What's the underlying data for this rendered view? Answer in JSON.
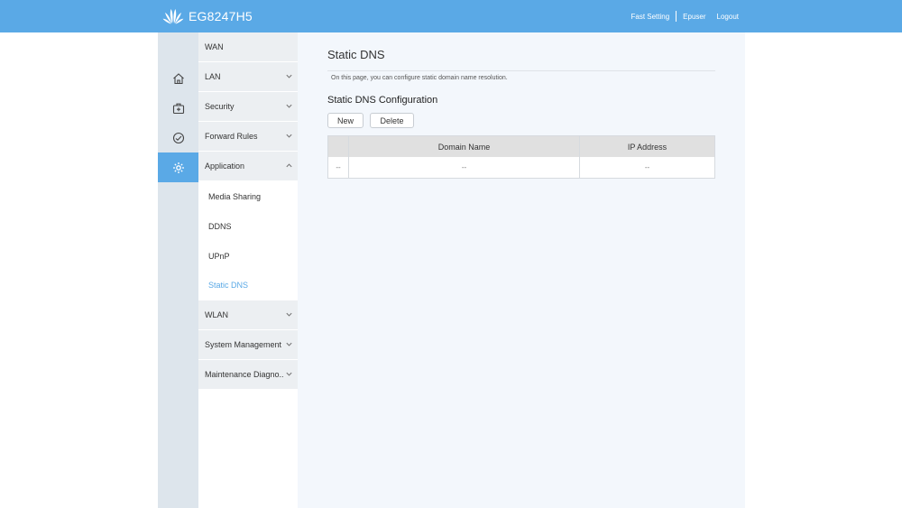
{
  "header": {
    "brand_icon": "huawei-petal-logo",
    "model": "EG8247H5",
    "links": [
      "Fast Setting",
      "Epuser",
      "Logout"
    ]
  },
  "iconbar": {
    "items": [
      {
        "icon": "home-icon"
      },
      {
        "icon": "toolbox-icon"
      },
      {
        "icon": "gauge-icon"
      },
      {
        "icon": "gear-icon",
        "active": true
      }
    ]
  },
  "menu": {
    "items": [
      "WAN",
      "LAN",
      "Security",
      "Forward Rules",
      "Application",
      "WLAN",
      "System Management",
      "Maintenance Diagno.."
    ],
    "application_subitems": [
      "Media Sharing",
      "DDNS",
      "UPnP",
      "Static DNS"
    ],
    "active_subitem": "Static DNS"
  },
  "page": {
    "title": "Static DNS",
    "description": "On this page, you can configure static domain name resolution.",
    "section_title": "Static DNS Configuration",
    "buttons": {
      "new": "New",
      "delete": "Delete"
    }
  },
  "table": {
    "columns": [
      "",
      "Domain Name",
      "IP Address"
    ],
    "rows": [
      [
        "--",
        "--",
        "--"
      ]
    ]
  },
  "colors": {
    "accent": "#5aa9e6",
    "content_bg": "#f3f7fc",
    "sidebar_bg": "#dde5ec",
    "menu_bg": "#eceff2"
  }
}
